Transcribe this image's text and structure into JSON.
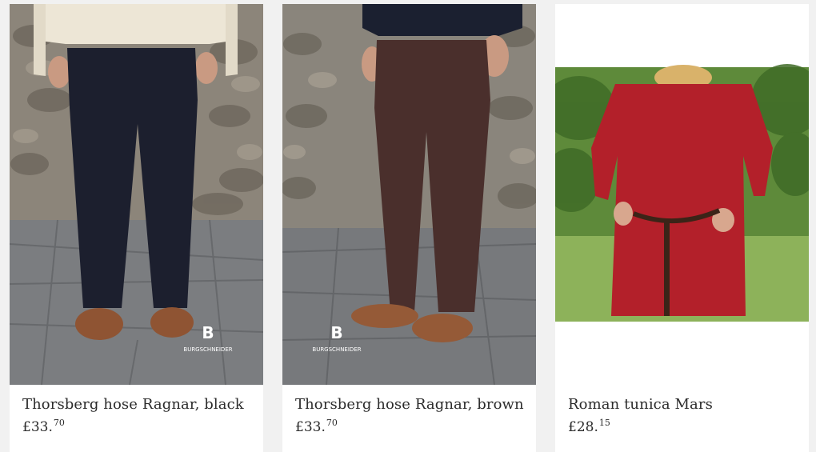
{
  "products": [
    {
      "title": "Thorsberg hose Ragnar, black",
      "price_main": "£33.",
      "price_cents": "70",
      "brand": "BURGSCHNEIDER",
      "color": "#1c1f2e"
    },
    {
      "title": "Thorsberg hose Ragnar, brown",
      "price_main": "£33.",
      "price_cents": "70",
      "brand": "BURGSCHNEIDER",
      "color": "#4a2f2c"
    },
    {
      "title": "Roman tunica Mars",
      "price_main": "£28.",
      "price_cents": "15",
      "color": "#b3202a"
    }
  ]
}
